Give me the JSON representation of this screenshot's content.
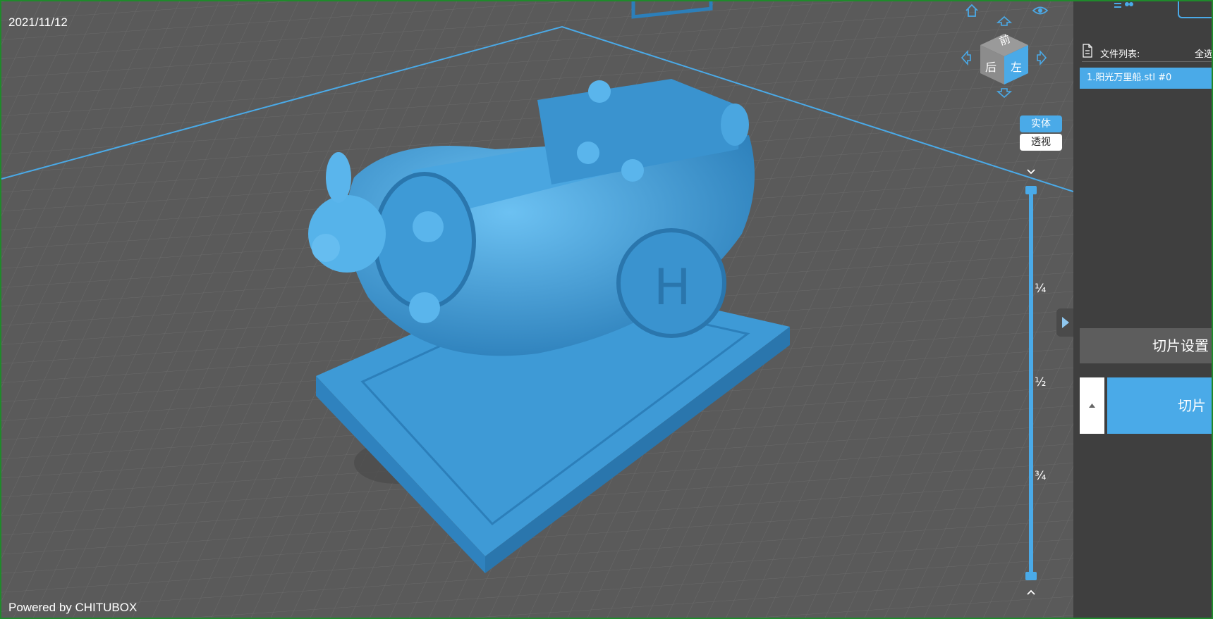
{
  "viewport": {
    "date": "2021/11/12",
    "powered_by": "Powered by CHITUBOX",
    "model_color": "#3e9ad6",
    "grid_color": "#5a5a5a",
    "view_cube": {
      "faces": {
        "top": "前",
        "left": "后",
        "right": "左"
      },
      "icons": [
        "home-icon",
        "eye-icon",
        "arrow-up-icon",
        "arrow-down-icon",
        "arrow-left-icon",
        "arrow-right-icon"
      ]
    },
    "render_modes": {
      "solid": "实体",
      "xray": "透视",
      "active": "solid"
    },
    "layer_slider": {
      "ticks": [
        "¼",
        "½",
        "¾"
      ],
      "top_fraction": 1.0,
      "bottom_fraction": 0.0
    }
  },
  "right_panel": {
    "file_list_label": "文件列表:",
    "select_all": "全选",
    "files": [
      {
        "name": "1.阳光万里船.stl #0",
        "selected": true
      }
    ],
    "slice_settings": "切片设置",
    "slice": "切片"
  },
  "colors": {
    "accent": "#4aaae8",
    "panel_bg": "#3f3f3f",
    "viewport_bg": "#5a5a5a"
  }
}
